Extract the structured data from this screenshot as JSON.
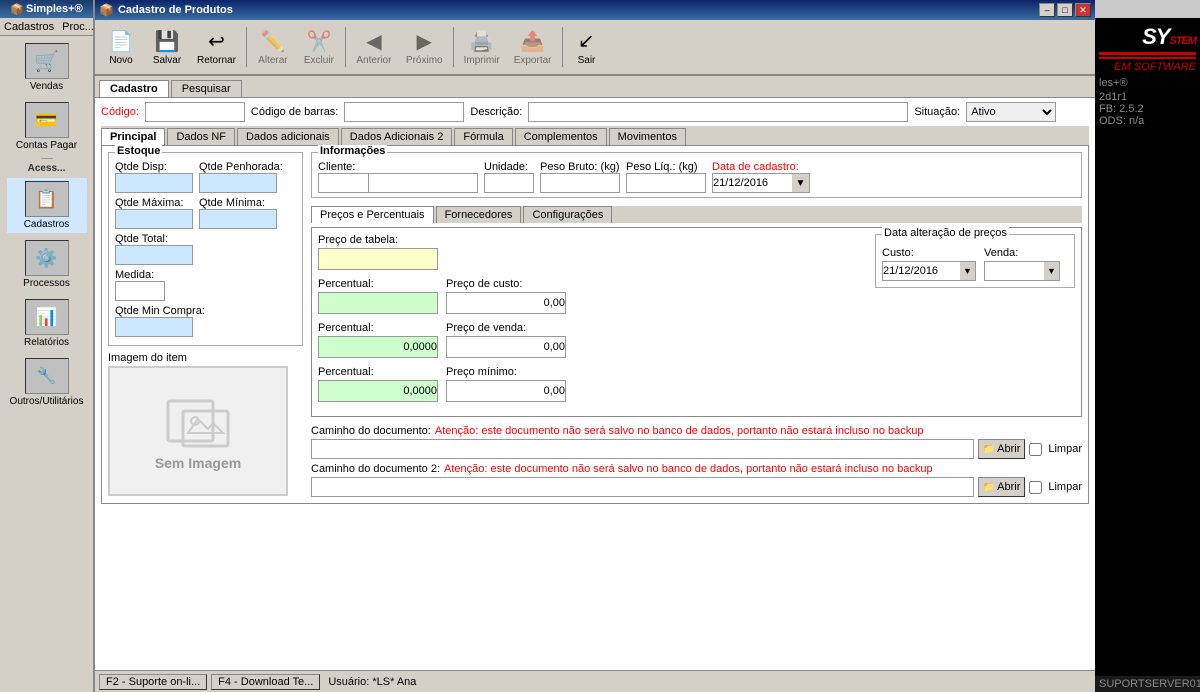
{
  "window": {
    "title": "Cadastro de Produtos",
    "app_icon": "📦"
  },
  "titlebar_buttons": {
    "minimize": "–",
    "maximize": "□",
    "close": "✕"
  },
  "menu": {
    "items": [
      "Cadastros",
      "Proc..."
    ]
  },
  "toolbar": {
    "buttons": [
      {
        "label": "Novo",
        "icon": "📄",
        "disabled": false
      },
      {
        "label": "Salvar",
        "icon": "💾",
        "disabled": false
      },
      {
        "label": "Retornar",
        "icon": "↩",
        "disabled": false
      },
      {
        "label": "Alterar",
        "icon": "✏️",
        "disabled": true
      },
      {
        "label": "Excluir",
        "icon": "✂️",
        "disabled": true
      },
      {
        "label": "Anterior",
        "icon": "◀",
        "disabled": true
      },
      {
        "label": "Próximo",
        "icon": "▶",
        "disabled": true
      },
      {
        "label": "Imprimir",
        "icon": "🖨️",
        "disabled": true
      },
      {
        "label": "Exportar",
        "icon": "📤",
        "disabled": true
      },
      {
        "label": "Sair",
        "icon": "↖",
        "disabled": false
      }
    ]
  },
  "top_tabs": [
    {
      "label": "Cadastro",
      "active": true
    },
    {
      "label": "Pesquisar",
      "active": false
    }
  ],
  "header_fields": {
    "codigo_label": "Código:",
    "codigo_value": "",
    "barras_label": "Código de barras:",
    "barras_value": "",
    "descricao_label": "Descrição:",
    "descricao_value": "",
    "situacao_label": "Situação:",
    "situacao_value": "Ativo",
    "situacao_options": [
      "Ativo",
      "Inativo"
    ]
  },
  "main_tabs": [
    {
      "label": "Principal",
      "active": true
    },
    {
      "label": "Dados NF",
      "active": false
    },
    {
      "label": "Dados adicionais",
      "active": false
    },
    {
      "label": "Dados Adicionais 2",
      "active": false
    },
    {
      "label": "Fórmula",
      "active": false
    },
    {
      "label": "Complementos",
      "active": false
    },
    {
      "label": "Movimentos",
      "active": false
    }
  ],
  "estoque": {
    "label": "Estoque",
    "qtde_disp_label": "Qtde Disp:",
    "qtde_disp_value": "",
    "qtde_penhorada_label": "Qtde Penhorada:",
    "qtde_penhorada_value": "",
    "qtde_maxima_label": "Qtde Máxima:",
    "qtde_maxima_value": "",
    "qtde_minima_label": "Qtde Mínima:",
    "qtde_minima_value": "",
    "qtde_total_label": "Qtde Total:",
    "qtde_total_value": "",
    "medida_label": "Medida:",
    "medida_value": "",
    "qtde_min_compra_label": "Qtde Min Compra:",
    "qtde_min_compra_value": ""
  },
  "informacoes": {
    "label": "Informações",
    "cliente_label": "Cliente:",
    "cliente_value": "",
    "unidade_label": "Unidade:",
    "unidade_value": "",
    "peso_bruto_label": "Peso Bruto: (kg)",
    "peso_bruto_value": "",
    "peso_liq_label": "Peso Líq.: (kg)",
    "peso_liq_value": "",
    "data_cadastro_label": "Data de cadastro:",
    "data_cadastro_value": "21/12/2016"
  },
  "preco_tabs": [
    {
      "label": "Preços e Percentuais",
      "active": true
    },
    {
      "label": "Fornecedores",
      "active": false
    },
    {
      "label": "Configurações",
      "active": false
    }
  ],
  "precos": {
    "preco_tabela_label": "Preço de tabela:",
    "preco_tabela_value": "",
    "percentual1_label": "Percentual:",
    "percentual1_value": "",
    "preco_custo_label": "Preço de custo:",
    "preco_custo_value": "0,00",
    "percentual2_label": "Percentual:",
    "percentual2_value": "0,0000",
    "preco_venda_label": "Preço de venda:",
    "preco_venda_value": "0,00",
    "percentual3_label": "Percentual:",
    "percentual3_value": "0,0000",
    "preco_minimo_label": "Preço mínimo:",
    "preco_minimo_value": "0,00"
  },
  "data_alteracao": {
    "label": "Data alteração de preços",
    "custo_label": "Custo:",
    "custo_value": "21/12/2016",
    "venda_label": "Venda:",
    "venda_value": ""
  },
  "imagem": {
    "label": "Imagem do item",
    "sem_imagem_text": "Sem Imagem"
  },
  "documento": {
    "caminho1_label": "Caminho do documento:",
    "caminho1_warning": "Atenção: este documento não será salvo no banco de dados, portanto não estará incluso no backup",
    "caminho1_value": "",
    "abrir1_label": "Abrir",
    "limpar1_label": "Limpar",
    "caminho2_label": "Caminho do documento 2:",
    "caminho2_warning": "Atenção: este documento não será salvo no banco de dados, portanto não estará incluso no backup",
    "caminho2_value": "",
    "abrir2_label": "Abrir",
    "limpar2_label": "Limpar"
  },
  "sidebar": {
    "items": [
      {
        "label": "Vendas",
        "icon": "🛒"
      },
      {
        "label": "Contas Pagar",
        "icon": "💳"
      },
      {
        "label": "Cadastros",
        "icon": "📋"
      },
      {
        "label": "Processos",
        "icon": "⚙️"
      },
      {
        "label": "Relatórios",
        "icon": "📊"
      },
      {
        "label": "Outros/Utilitários",
        "icon": "🔧"
      }
    ]
  },
  "right_panel": {
    "system_text": "SYSTEM",
    "subtitle": "EM SOFTWARE",
    "info1": "les+®",
    "info2": "2d1r1",
    "info3": "FB: 2.5.2",
    "info4": "ODS: n/a",
    "server_text": "SUPORTSERVER01"
  },
  "bottom_bar": {
    "btn1": "F2 - Suporte on-li...",
    "btn2": "F4 - Download Te...",
    "user": "Usuário: *LS* Ana"
  }
}
